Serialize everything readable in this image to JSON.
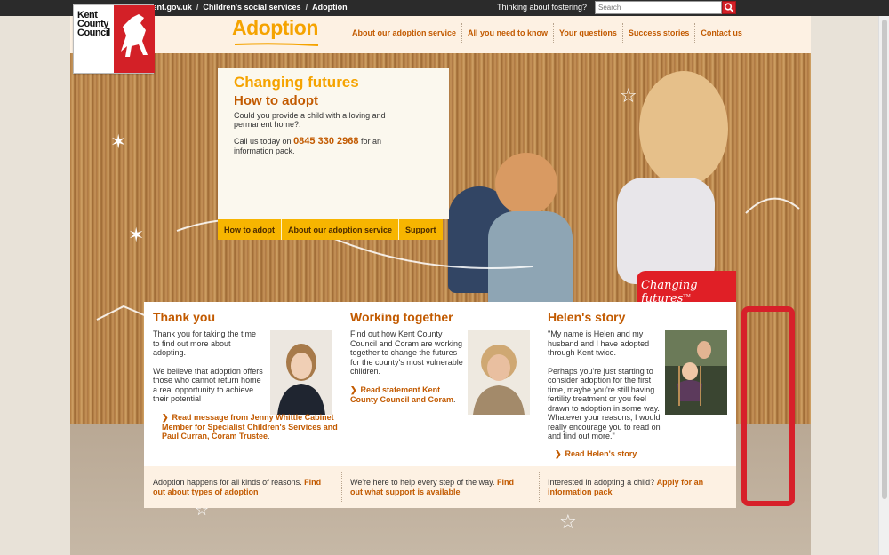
{
  "topbar": {
    "breadcrumbs": [
      "Kent.gov.uk",
      "Children's social services",
      "Adoption"
    ],
    "separator": "/",
    "fostering_text": "Thinking about fostering?",
    "search_placeholder": "Search"
  },
  "header": {
    "logo_text": "Kent County Council",
    "site_title": "Adoption",
    "nav": [
      "About our adoption service",
      "All you need to know",
      "Your questions",
      "Success stories",
      "Contact us"
    ]
  },
  "hero": {
    "title": "Changing futures",
    "subtitle": "How to adopt",
    "intro": "Could you provide a child with a loving and permanent home?.",
    "call_prefix": "Call us today on",
    "phone": "0845 330 2968",
    "call_suffix": "for an information pack.",
    "subnav": [
      "How to adopt",
      "About our adoption service",
      "Support"
    ],
    "badge": "Changing futures",
    "badge_mark": "TM"
  },
  "panels": [
    {
      "title": "Thank you",
      "paragraphs": [
        "Thank you for taking the time to find out more about adopting.",
        "We believe that adoption offers those who cannot return home a real opportunity to achieve their potential"
      ],
      "link": "Read message from Jenny Whittle Cabinet Member for Specialist Children's Services and Paul Curran, Coram Trustee",
      "link_end": "."
    },
    {
      "title": "Working together",
      "paragraphs": [
        "Find out how Kent County Council and Coram are working together to change the futures for the county's most vulnerable children."
      ],
      "link": "Read statement Kent County Council and Coram",
      "link_end": "."
    },
    {
      "title": "Helen's story",
      "paragraphs": [
        "\"My name is Helen and my husband and I have adopted through Kent twice.",
        "Perhaps you're just starting to consider adoption for the first time, maybe you're still having fertility treatment or you feel drawn to adoption in some way. Whatever your reasons, I would really encourage you to read on and find out more.\""
      ],
      "link": "Read Helen's story",
      "link_end": ""
    }
  ],
  "footer": [
    {
      "text": "Adoption happens for all kinds of reasons.",
      "link": "Find out about types of adoption"
    },
    {
      "text": "We're here to help every step of the way.",
      "link": "Find out what support is available"
    },
    {
      "text": "Interested in adopting a child?",
      "link": "Apply for an information pack"
    }
  ],
  "colors": {
    "brand_orange": "#c25a00",
    "brand_yellow": "#f5a300",
    "kcc_red": "#d32027"
  },
  "icons": [
    "search-icon",
    "chevron-right-icon"
  ]
}
